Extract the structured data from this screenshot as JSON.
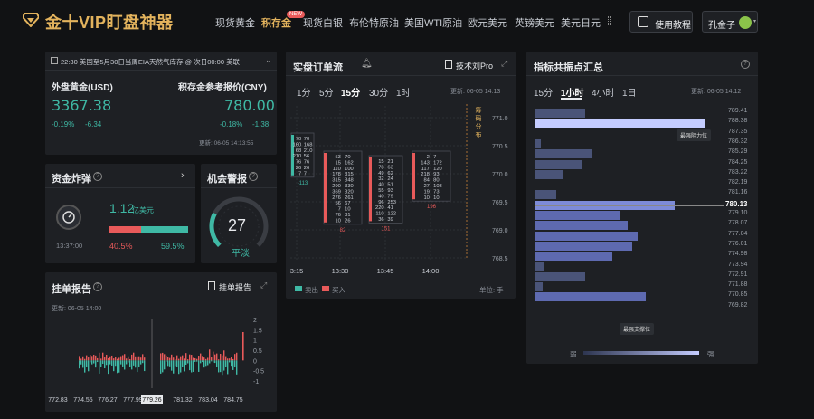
{
  "app": {
    "brand": "金十VIP盯盘神器",
    "new_badge": "NEW",
    "user_name": "孔金子",
    "tutorial": "使用教程"
  },
  "nav": [
    "现货黄金",
    "积存金",
    "现货白银",
    "布伦特原油",
    "美国WTI原油",
    "欧元美元",
    "英镑美元",
    "美元日元"
  ],
  "nav_active": 1,
  "ticker": {
    "text": "22:30 美国至5月30日当周EIA天然气库存 @ 次日00:00 美联"
  },
  "gold": {
    "left_title": "外盘黄金(USD)",
    "left_price": "3367.38",
    "left_pct": "-0.19%",
    "left_chg": "-6.34",
    "right_title": "积存金参考报价(CNY)",
    "right_price": "780.00",
    "right_pct": "-0.18%",
    "right_chg": "-1.38",
    "updated": "更新: 06-05 14:13:55"
  },
  "flow": {
    "title": "资金炸弹",
    "amount": "1.12",
    "unit": "亿美元",
    "time": "13:37:00",
    "sell_pct": "40.5%",
    "buy_pct": "59.5%",
    "buy_fraction": 0.595
  },
  "alert": {
    "title": "机会警报",
    "value": "27",
    "status": "平淡",
    "level": 0.27
  },
  "pending": {
    "title": "挂单报告",
    "link": "挂单报告",
    "updated": "更新: 06-05 14:00",
    "x_ticks": [
      "772.83",
      "774.55",
      "776.27",
      "777.99",
      "779.26",
      "781.32",
      "783.04",
      "784.75"
    ],
    "y_ticks": [
      "2",
      "1.5",
      "1",
      "0.5",
      "0",
      "-0.5",
      "-1"
    ]
  },
  "orderflow": {
    "title": "实盘订单流",
    "link": "技术刘Pro",
    "tabs": [
      "1分",
      "5分",
      "15分",
      "30分",
      "1时"
    ],
    "active_tab": 2,
    "updated": "更新: 06-05 14:13",
    "side_label": "筹码分布",
    "y_ticks": [
      "771.0",
      "770.5",
      "770.0",
      "769.5",
      "769.0",
      "768.5"
    ],
    "x_ticks": [
      "3:15",
      "13:30",
      "13:45",
      "14:00"
    ],
    "legend_sell": "卖出",
    "legend_buy": "买入",
    "unit": "单位: 手",
    "candles": [
      {
        "sell": [
          "70",
          "160",
          "68",
          "210",
          "76",
          "26",
          "7"
        ],
        "buy": [
          "70",
          "168",
          "210",
          "56",
          "76",
          "26",
          "7"
        ],
        "total": "-113",
        "total_color": "#3fb9a5"
      },
      {
        "sell": [
          "53",
          "15",
          "110",
          "178",
          "315",
          "290",
          "369",
          "276",
          "56",
          "7",
          "76",
          "10"
        ],
        "buy": [
          "70",
          "162",
          "100",
          "315",
          "348",
          "330",
          "320",
          "261",
          "67",
          "10",
          "31",
          "26"
        ],
        "total": "82",
        "total_color": "#e85a5a"
      },
      {
        "sell": [
          "15",
          "78",
          "49",
          "32",
          "40",
          "55",
          "40",
          "96",
          "220",
          "110",
          "36"
        ],
        "buy": [
          "21",
          "63",
          "62",
          "24",
          "51",
          "93",
          "79",
          "253",
          "41",
          "122",
          "39"
        ],
        "total": "151",
        "total_color": "#e85a5a"
      },
      {
        "sell": [
          "2",
          "143",
          "117",
          "218",
          "84",
          "27",
          "19",
          "10"
        ],
        "buy": [
          "7",
          "172",
          "120",
          "93",
          "80",
          "103",
          "73",
          "10"
        ],
        "total": "196",
        "total_color": "#e85a5a"
      }
    ]
  },
  "resonance": {
    "title": "指标共振点汇总",
    "tabs": [
      "15分",
      "1小时",
      "4小时",
      "1日"
    ],
    "active_tab": 1,
    "updated": "更新: 06-05 14:12",
    "y_ticks": [
      "789.41",
      "788.38",
      "787.35",
      "786.32",
      "785.29",
      "784.25",
      "783.22",
      "782.19",
      "781.16",
      "780.13",
      "779.10",
      "778.07",
      "777.04",
      "776.01",
      "774.98",
      "773.94",
      "772.91",
      "771.88",
      "770.85",
      "769.82"
    ],
    "current": "780.13",
    "bars": [
      0.29,
      1.0,
      0,
      0.03,
      0.33,
      0.27,
      0.16,
      0,
      0.12,
      0.82,
      0.5,
      0.54,
      0.6,
      0.57,
      0.45,
      0.05,
      0.29,
      0.04,
      0.65,
      0
    ],
    "resistance_label": "最强阻力位",
    "support_label": "最强支撑位",
    "weak": "弱",
    "strong": "强"
  }
}
